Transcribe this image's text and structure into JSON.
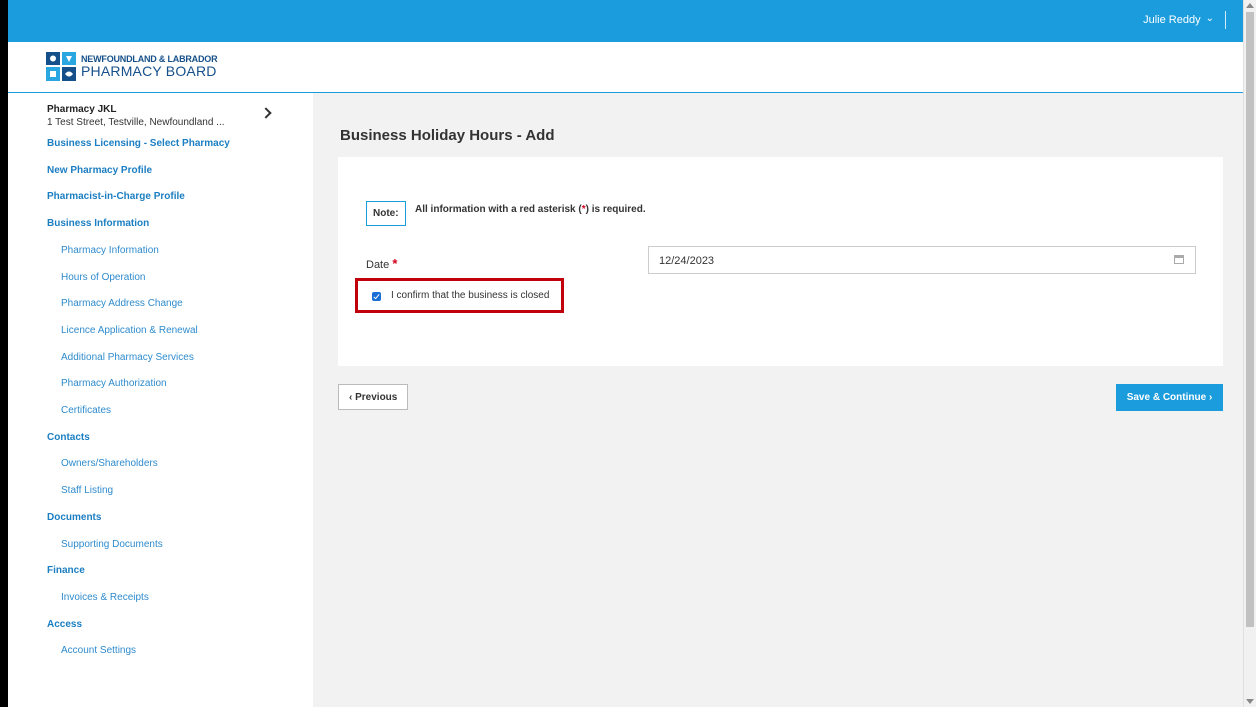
{
  "topbar": {
    "user_name": "Julie Reddy",
    "dropdown_glyph": "⌄"
  },
  "brand": {
    "line1": "NEWFOUNDLAND & LABRADOR",
    "line2": "PHARMACY BOARD",
    "color": "#16508a"
  },
  "sidebar": {
    "pharmacy_name": "Pharmacy JKL",
    "pharmacy_address": "1 Test Street, Testville, Newfoundland ...",
    "items": [
      {
        "label": "Business Licensing - Select Pharmacy",
        "type": "head"
      },
      {
        "label": "New Pharmacy Profile",
        "type": "head"
      },
      {
        "label": "Pharmacist-in-Charge Profile",
        "type": "head"
      },
      {
        "label": "Business Information",
        "type": "head"
      },
      {
        "label": "Pharmacy Information",
        "type": "sub"
      },
      {
        "label": "Hours of Operation",
        "type": "sub"
      },
      {
        "label": "Pharmacy Address Change",
        "type": "sub"
      },
      {
        "label": "Licence Application & Renewal",
        "type": "sub"
      },
      {
        "label": "Additional Pharmacy Services",
        "type": "sub"
      },
      {
        "label": "Pharmacy Authorization",
        "type": "sub"
      },
      {
        "label": "Certificates",
        "type": "sub"
      },
      {
        "label": "Contacts",
        "type": "head"
      },
      {
        "label": "Owners/Shareholders",
        "type": "sub"
      },
      {
        "label": "Staff Listing",
        "type": "sub"
      },
      {
        "label": "Documents",
        "type": "head"
      },
      {
        "label": "Supporting Documents",
        "type": "sub"
      },
      {
        "label": "Finance",
        "type": "head"
      },
      {
        "label": "Invoices & Receipts",
        "type": "sub"
      },
      {
        "label": "Access",
        "type": "head"
      },
      {
        "label": "Account Settings",
        "type": "sub"
      }
    ]
  },
  "main": {
    "title": "Business Holiday Hours - Add",
    "note_label": "Note:",
    "note_text_before": "All information with a red asterisk (",
    "note_asterisk": "*",
    "note_text_after": ") is required.",
    "date_label": "Date",
    "required_mark": "*",
    "date_value": "12/24/2023",
    "confirm_label": "I confirm that the business is closed",
    "confirm_checked": true,
    "prev_label": "‹ Previous",
    "save_label": "Save & Continue ›"
  },
  "colors": {
    "accent": "#1b9cdc",
    "highlight_border": "#c0000a",
    "required": "#d0021b",
    "link": "#1b7ec2"
  }
}
